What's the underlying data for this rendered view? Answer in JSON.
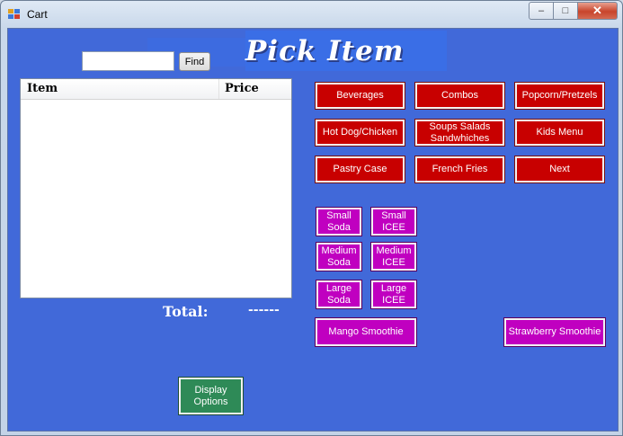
{
  "window": {
    "title": "Cart"
  },
  "caption": {
    "minimize": "–",
    "maximize": "□",
    "close": "✕"
  },
  "search": {
    "value": "",
    "button": "Find"
  },
  "heading": "Pick Item",
  "list": {
    "columns": [
      "Item",
      "Price"
    ],
    "rows": []
  },
  "total": {
    "label": "Total:",
    "value": "------"
  },
  "categories": [
    "Beverages",
    "Combos",
    "Popcorn/Pretzels",
    "Hot Dog/Chicken",
    "Soups Salads Sandwhiches",
    "Kids Menu",
    "Pastry Case",
    "French Fries",
    "Next"
  ],
  "drinks": [
    "Small Soda",
    "Small ICEE",
    "Medium Soda",
    "Medium ICEE",
    "Large Soda",
    "Large ICEE"
  ],
  "smoothies": [
    "Mango Smoothie",
    "Strawberry Smoothie"
  ],
  "display_options": "Display Options",
  "colors": {
    "background": "#4169d9",
    "category_button": "#c80000",
    "drink_button": "#c000c0",
    "display_button": "#2e8a57"
  }
}
